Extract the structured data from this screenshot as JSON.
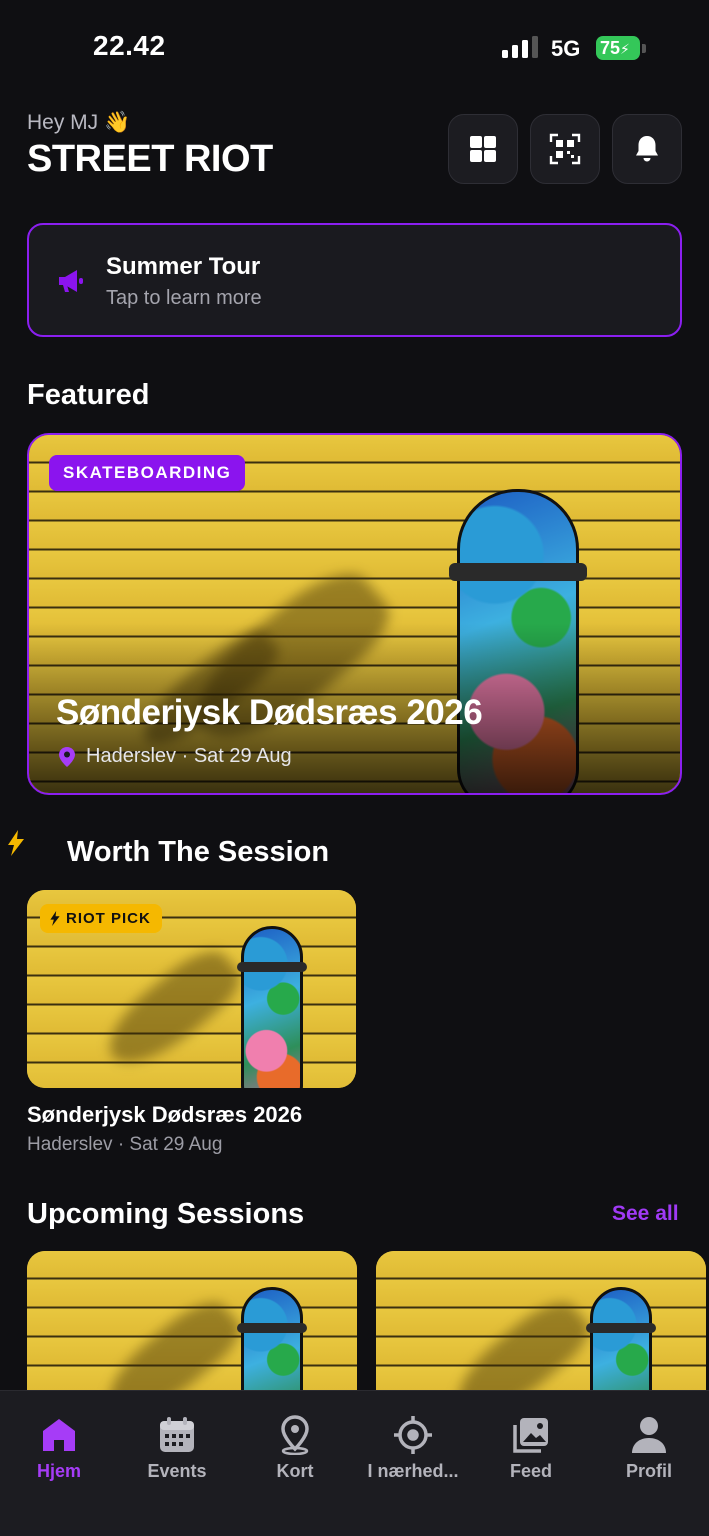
{
  "status_bar": {
    "time": "22.42",
    "network": "5G",
    "battery": "75"
  },
  "header": {
    "greeting": "Hey MJ 👋",
    "brand": "STREET RIOT"
  },
  "header_buttons": [
    {
      "icon": "grid-icon"
    },
    {
      "icon": "qr-code-icon"
    },
    {
      "icon": "bell-icon"
    }
  ],
  "promo": {
    "title": "Summer Tour",
    "subtitle": "Tap to learn more",
    "icon": "megaphone-icon"
  },
  "featured": {
    "section_title": "Featured",
    "tag": "SKATEBOARDING",
    "title": "Sønderjysk Dødsræs 2026",
    "location": "Haderslev · Sat 29 Aug"
  },
  "worth_session": {
    "section_title": "Worth The Session",
    "badge": "RIOT PICK",
    "title": "Sønderjysk Dødsræs 2026",
    "location": "Haderslev · Sat 29 Aug"
  },
  "upcoming": {
    "section_title": "Upcoming Sessions",
    "see_all": "See all"
  },
  "tabs": [
    {
      "label": "Hjem",
      "icon": "home-icon",
      "active": true
    },
    {
      "label": "Events",
      "icon": "calendar-icon",
      "active": false
    },
    {
      "label": "Kort",
      "icon": "map-pin-icon",
      "active": false
    },
    {
      "label": "I nærhed...",
      "icon": "target-icon",
      "active": false
    },
    {
      "label": "Feed",
      "icon": "photos-icon",
      "active": false
    },
    {
      "label": "Profil",
      "icon": "person-icon",
      "active": false
    }
  ],
  "colors": {
    "accent": "#8b14ee",
    "highlight": "#f5b800",
    "background": "#0f0f12"
  }
}
